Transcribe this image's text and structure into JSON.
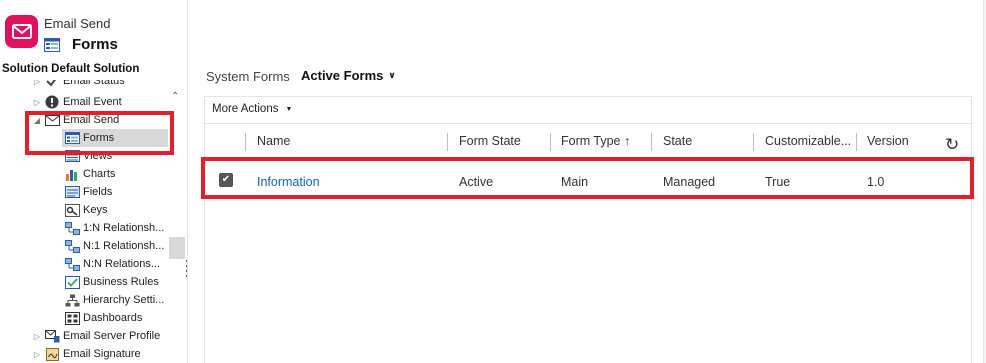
{
  "header": {
    "entity_name": "Email Send",
    "page_title": "Forms",
    "solution_label": "Solution Default Solution"
  },
  "tree": [
    {
      "label": "Email Status",
      "icon": "status-icon",
      "expanded": false
    },
    {
      "label": "Email Event",
      "icon": "info-icon",
      "expanded": false
    },
    {
      "label": "Email Send",
      "icon": "envelope-icon",
      "expanded": true
    },
    {
      "label": "Forms",
      "icon": "form-icon",
      "selected": true
    },
    {
      "label": "Views",
      "icon": "view-icon"
    },
    {
      "label": "Charts",
      "icon": "chart-icon"
    },
    {
      "label": "Fields",
      "icon": "fields-icon"
    },
    {
      "label": "Keys",
      "icon": "key-icon"
    },
    {
      "label": "1:N Relationsh...",
      "icon": "relationship-icon"
    },
    {
      "label": "N:1 Relationsh...",
      "icon": "relationship-icon"
    },
    {
      "label": "N:N Relations...",
      "icon": "relationship-icon"
    },
    {
      "label": "Business Rules",
      "icon": "rules-icon"
    },
    {
      "label": "Hierarchy Setti...",
      "icon": "hierarchy-icon"
    },
    {
      "label": "Dashboards",
      "icon": "dashboard-icon"
    },
    {
      "label": "Email Server Profile",
      "icon": "server-profile-icon",
      "expanded": false
    },
    {
      "label": "Email Signature",
      "icon": "signature-icon",
      "expanded": false
    }
  ],
  "view": {
    "system_forms_label": "System Forms",
    "active_view": "Active Forms",
    "more_actions": "More Actions"
  },
  "grid": {
    "columns": [
      "Name",
      "Form State",
      "Form Type ↑",
      "State",
      "Customizable...",
      "Version"
    ],
    "rows": [
      {
        "name": "Information",
        "form_state": "Active",
        "form_type": "Main",
        "state": "Managed",
        "customizable": "True",
        "version": "1.0",
        "checked": true
      }
    ]
  },
  "colors": {
    "brand": "#e0115f",
    "highlight": "#e0202a",
    "link": "#1160b7",
    "selected_row": "#d8d8d8"
  }
}
